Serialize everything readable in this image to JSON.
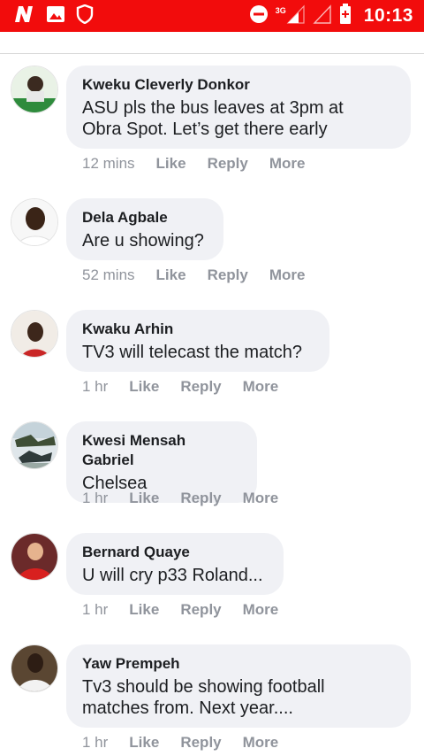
{
  "status_bar": {
    "time": "10:13",
    "network": "3G",
    "icons": [
      "brand-n-icon",
      "gallery-icon",
      "shield-icon",
      "do-not-disturb-icon",
      "signal-icon",
      "signal-empty-icon",
      "battery-charging-icon"
    ]
  },
  "colors": {
    "status_bar": "#f20c0c",
    "bubble": "#f0f1f5",
    "meta_text": "#90949c"
  },
  "comments": [
    {
      "author": "Kweku Cleverly Donkor",
      "text_lines": [
        "ASU pls the bus leaves at 3pm at",
        "Obra Spot. Let’s get there early"
      ],
      "time": "12 mins",
      "actions": [
        "Like",
        "Reply",
        "More"
      ]
    },
    {
      "author": "Dela Agbale",
      "text_lines": [
        "Are u showing?"
      ],
      "time": "52 mins",
      "actions": [
        "Like",
        "Reply",
        "More"
      ]
    },
    {
      "author": "Kwaku Arhin",
      "text_lines": [
        "TV3 will telecast the match?"
      ],
      "time": "1 hr",
      "actions": [
        "Like",
        "Reply",
        "More"
      ]
    },
    {
      "author": "Kwesi Mensah Gabriel",
      "text_lines": [
        "Chelsea"
      ],
      "time": "1 hr",
      "actions": [
        "Like",
        "Reply",
        "More"
      ]
    },
    {
      "author": "Bernard Quaye",
      "text_lines": [
        "U will cry p33 Roland..."
      ],
      "time": "1 hr",
      "actions": [
        "Like",
        "Reply",
        "More"
      ]
    },
    {
      "author": "Yaw Prempeh",
      "text_lines": [
        "Tv3 should be showing football",
        "matches from. Next year...."
      ],
      "time": "1 hr",
      "actions": [
        "Like",
        "Reply",
        "More"
      ]
    }
  ]
}
